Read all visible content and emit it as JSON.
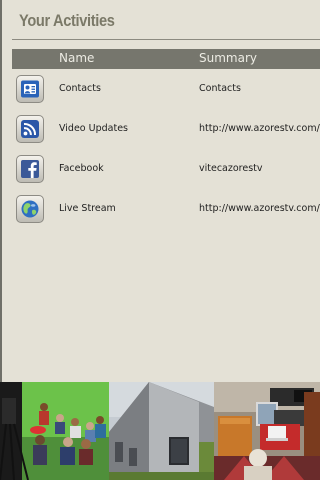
{
  "header": {
    "title": "Your Activities"
  },
  "table": {
    "columns": {
      "name": "Name",
      "summary": "Summary"
    },
    "rows": [
      {
        "icon": "contacts-icon",
        "name": "Contacts",
        "summary": "Contacts"
      },
      {
        "icon": "rss-icon",
        "name": "Video Updates",
        "summary": "http://www.azorestv.com/rss"
      },
      {
        "icon": "facebook-icon",
        "name": "Facebook",
        "summary": "vitecazorestv"
      },
      {
        "icon": "globe-icon",
        "name": "Live Stream",
        "summary": "http://www.azorestv.com/ind"
      }
    ]
  },
  "photo_strip": {
    "photos": [
      "tv-studio-photo",
      "building-photo",
      "office-photo"
    ]
  },
  "colors": {
    "background": "#e4e1d6",
    "header_bar": "#76766d",
    "title": "#7b7968",
    "contacts_icon": "#2a63b8",
    "rss_icon": "#2b57a8",
    "facebook_icon": "#3b5998",
    "globe_icon": "#2f6fc2"
  }
}
